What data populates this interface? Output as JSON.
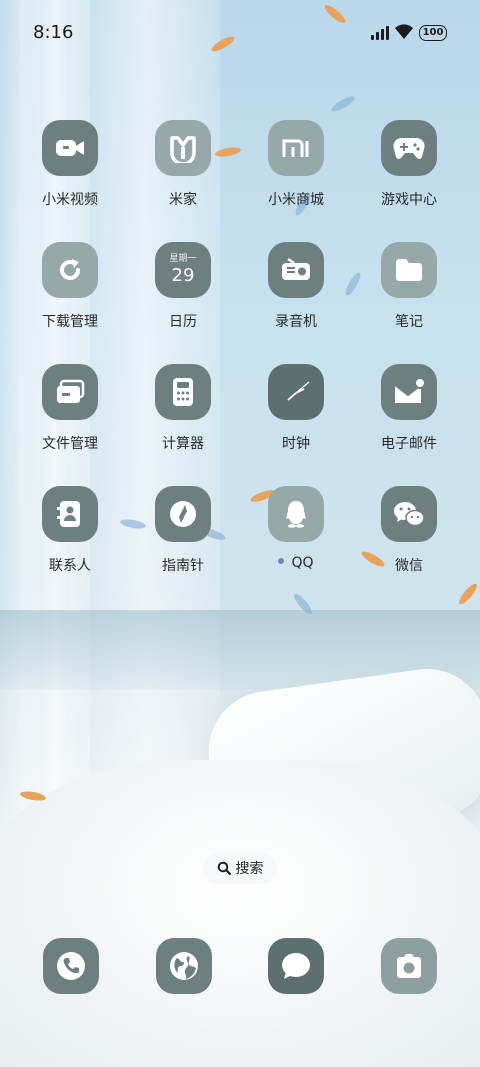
{
  "status_bar": {
    "time": "8:16",
    "battery": "100"
  },
  "apps": [
    {
      "label": "小米视频",
      "icon": "video-camera-icon"
    },
    {
      "label": "米家",
      "icon": "mijia-icon"
    },
    {
      "label": "小米商城",
      "icon": "mi-store-icon"
    },
    {
      "label": "游戏中心",
      "icon": "gamepad-icon"
    },
    {
      "label": "下载管理",
      "icon": "download-refresh-icon"
    },
    {
      "label": "日历",
      "icon": "calendar-icon",
      "weekday": "星期一",
      "day": "29"
    },
    {
      "label": "录音机",
      "icon": "radio-recorder-icon"
    },
    {
      "label": "笔记",
      "icon": "folder-icon"
    },
    {
      "label": "文件管理",
      "icon": "file-card-icon"
    },
    {
      "label": "计算器",
      "icon": "calculator-icon"
    },
    {
      "label": "时钟",
      "icon": "clock-icon"
    },
    {
      "label": "电子邮件",
      "icon": "mail-icon"
    },
    {
      "label": "联系人",
      "icon": "contacts-icon"
    },
    {
      "label": "指南针",
      "icon": "compass-icon"
    },
    {
      "label": "QQ",
      "icon": "qq-penguin-icon",
      "new_badge": true
    },
    {
      "label": "微信",
      "icon": "wechat-icon"
    }
  ],
  "search": {
    "label": "搜索"
  },
  "dock": [
    {
      "icon": "phone-icon"
    },
    {
      "icon": "browser-globe-icon"
    },
    {
      "icon": "message-icon"
    },
    {
      "icon": "camera-icon"
    }
  ]
}
